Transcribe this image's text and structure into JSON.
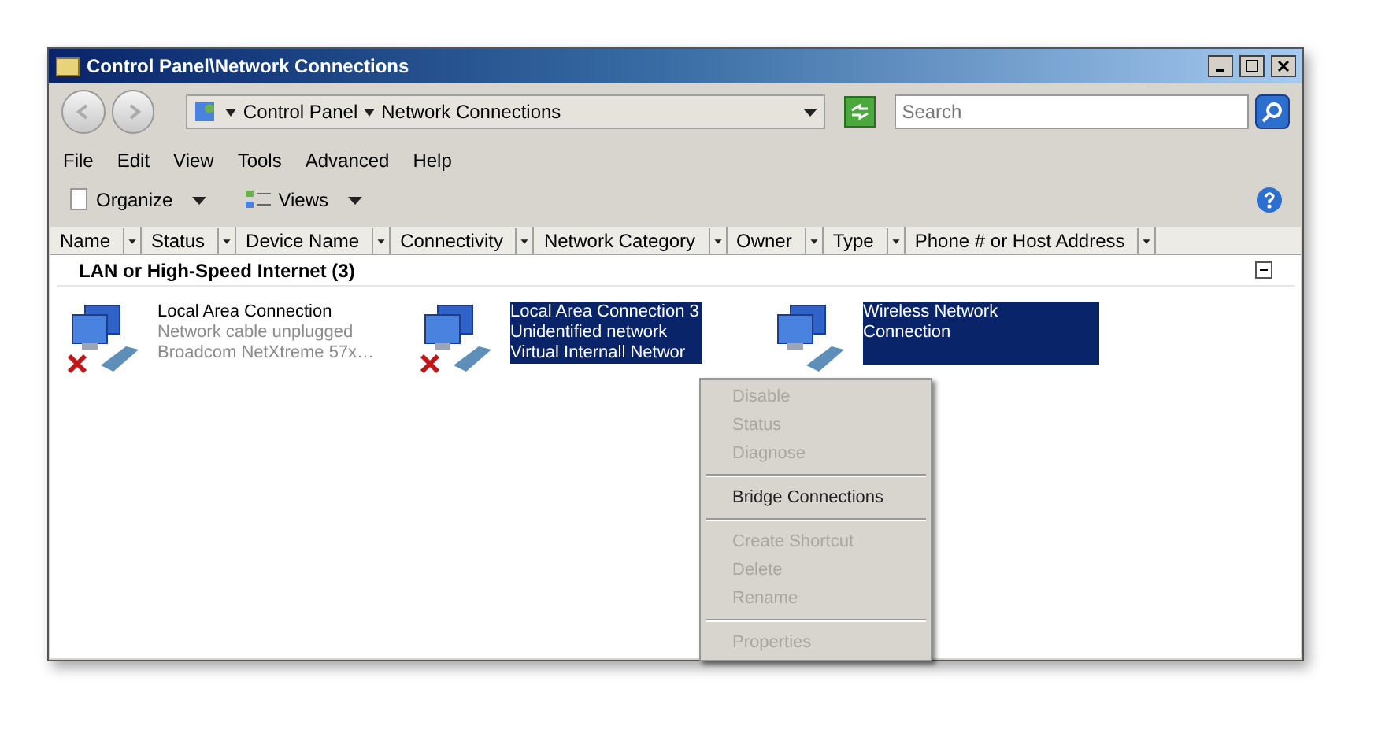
{
  "window": {
    "title": "Control Panel\\Network Connections"
  },
  "address": {
    "crumbs": [
      "Control Panel",
      "Network Connections"
    ]
  },
  "search": {
    "placeholder": "Search"
  },
  "menu_bar": [
    "File",
    "Edit",
    "View",
    "Tools",
    "Advanced",
    "Help"
  ],
  "toolbar": [
    {
      "label": "Organize",
      "kind": "organize"
    },
    {
      "label": "Views",
      "kind": "views"
    }
  ],
  "columns": [
    "Name",
    "Status",
    "Device Name",
    "Connectivity",
    "Network Category",
    "Owner",
    "Type",
    "Phone # or Host Address"
  ],
  "group": {
    "title": "LAN or High-Speed Internet (3)",
    "expanded": true
  },
  "connections": [
    {
      "name": "Local Area Connection",
      "details": [
        "Network cable unplugged",
        "Broadcom NetXtreme 57x…"
      ],
      "disconnected": true,
      "selected": false
    },
    {
      "name": "Local Area Connection 3",
      "details": [
        "Unidentified network",
        "Virtual Internall Networ"
      ],
      "disconnected": true,
      "selected": true
    },
    {
      "name": "Wireless Network Connection",
      "disconnected": false,
      "selected": true
    }
  ],
  "context_menu": [
    {
      "label": "Disable",
      "disabled": true,
      "separator_before": false
    },
    {
      "label": "Status",
      "disabled": true,
      "separator_before": false
    },
    {
      "label": "Diagnose",
      "disabled": true,
      "separator_before": false
    },
    {
      "label": "Bridge Connections",
      "disabled": false,
      "separator_before": true
    },
    {
      "label": "Create Shortcut",
      "disabled": true,
      "separator_before": true
    },
    {
      "label": "Delete",
      "disabled": true,
      "separator_before": false
    },
    {
      "label": "Rename",
      "disabled": true,
      "separator_before": false
    },
    {
      "label": "Properties",
      "disabled": true,
      "separator_before": true
    }
  ]
}
